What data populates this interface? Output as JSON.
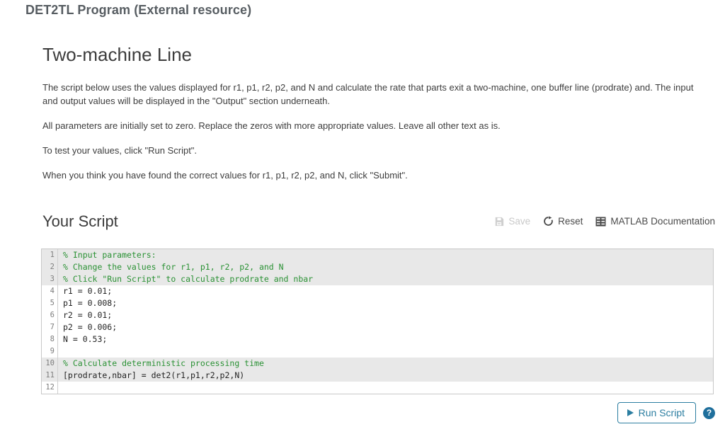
{
  "page": {
    "title": "DET2TL Program (External resource)"
  },
  "section": {
    "heading": "Two-machine Line",
    "paragraphs": [
      "The script below uses the values displayed for r1, p1, r2, p2, and N and calculate the rate that parts exit a two-machine, one buffer line (prodrate) and. The input and output values will be displayed in the \"Output\" section underneath.",
      "All parameters are initially set to zero. Replace the zeros with more appropriate values. Leave all other text as is.",
      "To test your values, click \"Run Script\".",
      "When you think you have found the correct values for r1, p1, r2, p2, and N, click \"Submit\"."
    ]
  },
  "script_panel": {
    "title": "Your Script",
    "tools": [
      {
        "label": "Save",
        "icon": "save-floppy-icon",
        "disabled": true
      },
      {
        "label": "Reset",
        "icon": "reset-circular-arrow-icon",
        "disabled": false
      },
      {
        "label": "MATLAB Documentation",
        "icon": "documentation-grid-icon",
        "disabled": false
      }
    ]
  },
  "editor": {
    "lines": [
      {
        "n": "1",
        "text": "% Input parameters:",
        "comment": true,
        "highlight": true
      },
      {
        "n": "2",
        "text": "% Change the values for r1, p1, r2, p2, and N",
        "comment": true,
        "highlight": true
      },
      {
        "n": "3",
        "text": "% Click \"Run Script\" to calculate prodrate and nbar",
        "comment": true,
        "highlight": true
      },
      {
        "n": "4",
        "text": "r1 = 0.01;",
        "comment": false,
        "highlight": false
      },
      {
        "n": "5",
        "text": "p1 = 0.008;",
        "comment": false,
        "highlight": false
      },
      {
        "n": "6",
        "text": "r2 = 0.01;",
        "comment": false,
        "highlight": false
      },
      {
        "n": "7",
        "text": "p2 = 0.006;",
        "comment": false,
        "highlight": false
      },
      {
        "n": "8",
        "text": "N = 0.53;",
        "comment": false,
        "highlight": false
      },
      {
        "n": "9",
        "text": "",
        "comment": false,
        "highlight": false
      },
      {
        "n": "10",
        "text": "% Calculate deterministic processing time",
        "comment": true,
        "highlight": true
      },
      {
        "n": "11",
        "text": "[prodrate,nbar] = det2(r1,p1,r2,p2,N)",
        "comment": false,
        "highlight": true
      },
      {
        "n": "12",
        "text": "",
        "comment": false,
        "highlight": false
      }
    ]
  },
  "run_bar": {
    "run_label": "Run Script",
    "help_label": "?"
  },
  "colors": {
    "accent": "#2c7ea1",
    "help_badge": "#1f6f9c",
    "comment_green": "#2a9134",
    "title_grey": "#575d62",
    "highlight_band": "#e8e8e8"
  }
}
